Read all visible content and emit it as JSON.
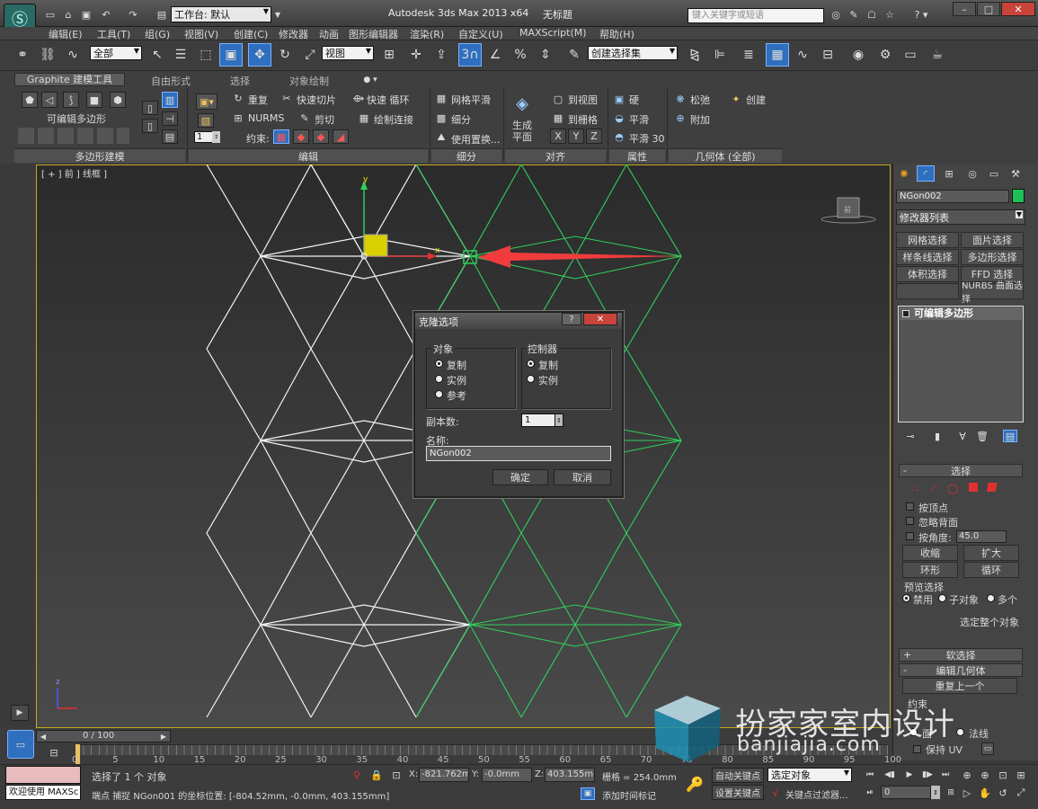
{
  "title_bar": {
    "workspace_label": "工作台: 默认",
    "app_title": "Autodesk 3ds Max  2013 x64",
    "doc_title": "无标题",
    "search_placeholder": "键入关键字或短语"
  },
  "menu": [
    "编辑(E)",
    "工具(T)",
    "组(G)",
    "视图(V)",
    "创建(C)",
    "修改器",
    "动画",
    "图形编辑器",
    "渲染(R)",
    "自定义(U)",
    "MAXScript(M)",
    "帮助(H)"
  ],
  "toolbar": {
    "filter_select": "全部",
    "ref_coord_select": "视图",
    "snap_label": "3",
    "named_selection_select": "创建选择集"
  },
  "ribbon": {
    "tabs": [
      "Graphite 建模工具",
      "自由形式",
      "选择",
      "对象绘制"
    ],
    "editable_poly": "可编辑多边形",
    "spinner_value": "1",
    "edit": {
      "repeat": "重复",
      "quickslice": "快速切片",
      "quickloop": "快速 循环",
      "nurms": "NURMS",
      "cut": "剪切",
      "paintconnect": "绘制连接",
      "constraint": "约束:"
    },
    "subdivide": {
      "meshsmooth": "网格平滑",
      "tessellate": "细分",
      "use_displace": "使用置换..."
    },
    "align": {
      "make_planar": "生成\n平面",
      "to_view": "到视图",
      "to_grid": "到栅格",
      "x": "X",
      "y": "Y",
      "z": "Z"
    },
    "props": {
      "hard": "硬",
      "smooth": "平滑",
      "smooth30": "平滑 30"
    },
    "geometry": {
      "relax": "松弛",
      "create": "创建",
      "attach": "附加"
    },
    "sections": [
      "多边形建模",
      "编辑",
      "细分",
      "对齐",
      "属性",
      "几何体 (全部)"
    ]
  },
  "viewport": {
    "label": "[ + ] 前 ] 线框 ]",
    "axis_y": "y",
    "axis_x": "x",
    "axis_z": "z"
  },
  "dialog": {
    "title": "克隆选项",
    "object_group": "对象",
    "object_options": [
      "复制",
      "实例",
      "参考"
    ],
    "controller_group": "控制器",
    "controller_options": [
      "复制",
      "实例"
    ],
    "copies_label": "副本数:",
    "copies_value": "1",
    "name_label": "名称:",
    "name_value": "NGon002",
    "ok": "确定",
    "cancel": "取消"
  },
  "command_panel": {
    "object_name": "NGon002",
    "modifier_list": "修改器列表",
    "modifier_buttons": [
      "网格选择",
      "面片选择",
      "样条线选择",
      "多边形选择",
      "体积选择",
      "FFD 选择",
      "",
      "NURBS 曲面选择"
    ],
    "stack_item": "可编辑多边形",
    "selection_rollout": "选择",
    "by_vertex": "按顶点",
    "ignore_backfacing": "忽略背面",
    "by_angle": "按角度:",
    "angle_value": "45.0",
    "shrink": "收缩",
    "grow": "扩大",
    "ring": "环形",
    "loop": "循环",
    "preview_selection": "预览选择",
    "preview_options": [
      "禁用",
      "子对象",
      "多个"
    ],
    "select_whole": "选定整个对象",
    "soft_selection": "软选择",
    "edit_geometry": "编辑几何体",
    "repeat_last": "重复上一个",
    "constraint_short": "约束",
    "face": "面",
    "normal": "法线",
    "preserve_uv": "保持 UV"
  },
  "timeline": {
    "counter": "0 / 100",
    "ticks": [
      "0",
      "5",
      "10",
      "15",
      "20",
      "25",
      "30",
      "35",
      "40",
      "45",
      "50",
      "55",
      "60",
      "65",
      "70",
      "75",
      "80",
      "85",
      "90",
      "95",
      "100"
    ]
  },
  "status": {
    "welcome": "欢迎使用 MAXSc",
    "selected": "选择了 1 个 对象",
    "prompt": "端点 捕捉 NGon001 的坐标位置: [-804.52mm, -0.0mm, 403.155mm]",
    "x_label": "X:",
    "x_value": "-821.762m",
    "y_label": "Y:",
    "y_value": "-0.0mm",
    "z_label": "Z:",
    "z_value": "403.155mm",
    "grid": "栅格 = 254.0mm",
    "add_time_tag": "添加时间标记",
    "auto_key": "自动关键点",
    "set_key": "设置关键点",
    "selected_object": "选定对象",
    "key_filters": "关键点过滤器...",
    "frame": "0"
  },
  "watermark": {
    "brand": "扮家家室内设计",
    "url": "banjiajia.com"
  }
}
